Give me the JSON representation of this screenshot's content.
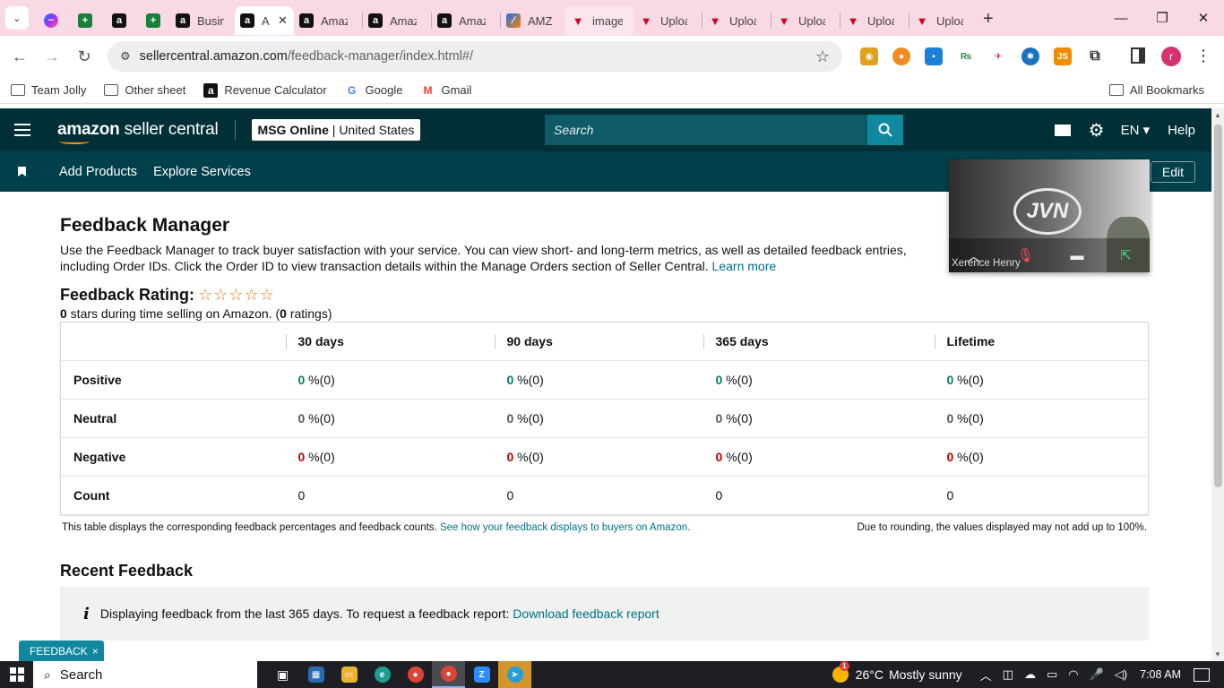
{
  "browser": {
    "tabs": [
      {
        "icon": "messenger-icon",
        "label": "",
        "pinned": true
      },
      {
        "icon": "sheets-icon",
        "label": "",
        "pinned": true
      },
      {
        "icon": "amazon-icon",
        "label": "",
        "pinned": true
      },
      {
        "icon": "sheets-icon",
        "label": "",
        "pinned": true
      },
      {
        "icon": "amazon-icon",
        "label": "Busin"
      },
      {
        "icon": "amazon-icon",
        "label": "A",
        "active": true
      },
      {
        "icon": "amazon-icon",
        "label": "Amaz"
      },
      {
        "icon": "amazon-icon",
        "label": "Amaz"
      },
      {
        "icon": "amazon-icon",
        "label": "Amaz"
      },
      {
        "icon": "amz-tool-icon",
        "label": "AMZ"
      },
      {
        "icon": "upload-icon",
        "label": "image"
      },
      {
        "icon": "upload-icon",
        "label": "Uploa"
      },
      {
        "icon": "upload-icon",
        "label": "Uploa"
      },
      {
        "icon": "upload-icon",
        "label": "Uploa"
      },
      {
        "icon": "upload-icon",
        "label": "Uploa"
      },
      {
        "icon": "upload-icon",
        "label": "Uploa"
      }
    ],
    "new_tab": "+",
    "address": {
      "host": "sellercentral.amazon.com",
      "path": "/feedback-manager/index.html#/"
    },
    "profile_initial": "r",
    "bookmarks": [
      {
        "icon": "folder-icon",
        "label": "Team Jolly"
      },
      {
        "icon": "folder-icon",
        "label": "Other sheet"
      },
      {
        "icon": "amazon-icon",
        "label": "Revenue Calculator"
      },
      {
        "icon": "google-icon",
        "label": "Google"
      },
      {
        "icon": "gmail-icon",
        "label": "Gmail"
      }
    ],
    "all_bookmarks": "All Bookmarks"
  },
  "header": {
    "logo_text_bold": "amazon",
    "logo_text": " seller central",
    "store_bold": "MSG Online",
    "store_sep": " | ",
    "store_region": "United States",
    "search_placeholder": "Search",
    "language": "EN",
    "help": "Help",
    "nav": [
      "Add Products",
      "Explore Services"
    ],
    "edit": "Edit"
  },
  "main": {
    "title": "Feedback Manager",
    "description": "Use the Feedback Manager to track buyer satisfaction with your service. You can view short- and long-term metrics, as well as detailed feedback entries, including Order IDs. Click the Order ID to view transaction details within the Manage Orders section of Seller Central.",
    "learn_more": "Learn more",
    "rating_label": "Feedback Rating:",
    "stars": "☆☆☆☆☆",
    "rating_stars": "0",
    "rating_sub_a": " stars during time selling on Amazon. (",
    "rating_count": "0",
    "rating_sub_b": " ratings)",
    "table": {
      "columns": [
        "30 days",
        "90 days",
        "365 days",
        "Lifetime"
      ],
      "rows": [
        {
          "label": "Positive",
          "cells": [
            {
              "pct": "0",
              "rest": " %(0)"
            },
            {
              "pct": "0",
              "rest": " %(0)"
            },
            {
              "pct": "0",
              "rest": " %(0)"
            },
            {
              "pct": "0",
              "rest": " %(0)"
            }
          ]
        },
        {
          "label": "Neutral",
          "cells": [
            {
              "pct": "0",
              "rest": " %(0)"
            },
            {
              "pct": "0",
              "rest": " %(0)"
            },
            {
              "pct": "0",
              "rest": " %(0)"
            },
            {
              "pct": "0",
              "rest": " %(0)"
            }
          ]
        },
        {
          "label": "Negative",
          "cells": [
            {
              "pct": "0",
              "rest": " %(0)"
            },
            {
              "pct": "0",
              "rest": " %(0)"
            },
            {
              "pct": "0",
              "rest": " %(0)"
            },
            {
              "pct": "0",
              "rest": " %(0)"
            }
          ]
        },
        {
          "label": "Count",
          "cells": [
            {
              "value": "0"
            },
            {
              "value": "0"
            },
            {
              "value": "0"
            },
            {
              "value": "0"
            }
          ]
        }
      ]
    },
    "table_note": "This table displays the corresponding feedback percentages and feedback counts.",
    "table_note_link": "See how your feedback displays to buyers on Amazon.",
    "rounding_note": "Due to rounding, the values displayed may not add up to 100%.",
    "recent_title": "Recent Feedback",
    "info_icon": "i",
    "info_text": "Displaying feedback from the last 365 days. To request a feedback report:",
    "info_link": "Download feedback report",
    "feedback_tag": "FEEDBACK",
    "feedback_tag_close": "×"
  },
  "video_call": {
    "caller": "Xerence Henry"
  },
  "taskbar": {
    "search": "Search",
    "weather_alert": "1",
    "temperature": "26°C",
    "weather": "Mostly sunny",
    "time": "7:08 AM"
  },
  "colors": {
    "header_bg": "#002f36",
    "subnav_bg": "#00404a",
    "search_btn": "#10899f",
    "positive": "#067d62",
    "negative": "#c40000",
    "link": "#007185"
  }
}
